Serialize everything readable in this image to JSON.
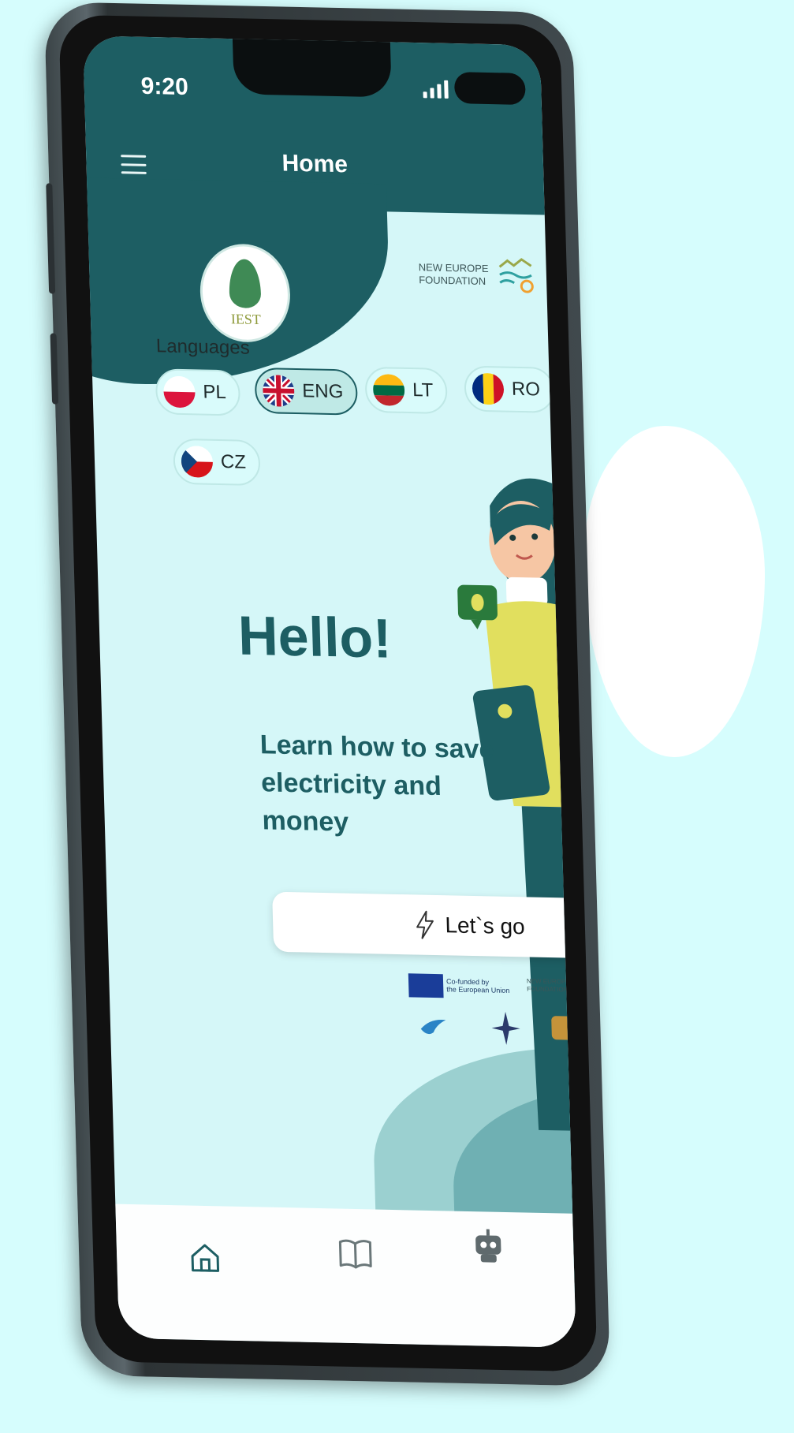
{
  "status": {
    "time": "9:20"
  },
  "header": {
    "title": "Home"
  },
  "logo": {
    "text": "IEST"
  },
  "foundation": {
    "line1": "NEW EUROPE",
    "line2": "FOUNDATION"
  },
  "languages": {
    "title": "Languages",
    "options": [
      {
        "label": "PL",
        "selected": false
      },
      {
        "label": "ENG",
        "selected": true
      },
      {
        "label": "LT",
        "selected": false
      },
      {
        "label": "RO",
        "selected": false
      },
      {
        "label": "CZ",
        "selected": false
      }
    ]
  },
  "hero": {
    "greeting": "Hello!",
    "subtitle": "Learn how to save electricity and money",
    "cta_label": "Let`s go"
  },
  "partners": {
    "eu_line1": "Co-funded by",
    "eu_line2": "the European Union",
    "nef_line1": "NEW EUROPE",
    "nef_line2": "FOUNDATION"
  },
  "colors": {
    "primary": "#1d5e63",
    "background": "#d5f7f8",
    "accent_yellow": "#e1df5e"
  },
  "bottom_nav": [
    {
      "icon": "home-icon",
      "active": true
    },
    {
      "icon": "book-icon",
      "active": false
    },
    {
      "icon": "robot-icon",
      "active": false
    }
  ]
}
